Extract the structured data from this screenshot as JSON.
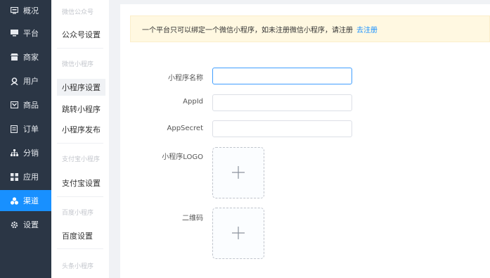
{
  "sidebar": {
    "items": [
      {
        "label": "概况",
        "icon": "dashboard-icon"
      },
      {
        "label": "平台",
        "icon": "monitor-icon"
      },
      {
        "label": "商家",
        "icon": "shop-icon"
      },
      {
        "label": "用户",
        "icon": "user-icon"
      },
      {
        "label": "商品",
        "icon": "goods-icon"
      },
      {
        "label": "订单",
        "icon": "order-icon"
      },
      {
        "label": "分销",
        "icon": "distribution-icon"
      },
      {
        "label": "应用",
        "icon": "apps-icon"
      },
      {
        "label": "渠道",
        "icon": "channel-icon",
        "active": true
      },
      {
        "label": "设置",
        "icon": "settings-icon"
      }
    ],
    "bg_color": "#2b3645",
    "active_color": "#1890ff"
  },
  "subnav": {
    "groups": {
      "wechat_official": "微信公众号",
      "wechat_mini": "微信小程序",
      "alipay_mini": "支付宝小程序",
      "baidu_mini": "百度小程序",
      "toutiao_mini": "头条小程序"
    },
    "items": {
      "official_settings": "公众号设置",
      "mini_settings": "小程序设置",
      "jump_mini": "跳转小程序",
      "mini_publish": "小程序发布",
      "alipay_settings": "支付宝设置",
      "baidu_settings": "百度设置"
    }
  },
  "notice": {
    "text": "一个平台只可以绑定一个微信小程序，如未注册微信小程序，请注册",
    "link": "去注册"
  },
  "form": {
    "name_label": "小程序名称",
    "appid_label": "AppId",
    "appsecret_label": "AppSecret",
    "logo_label": "小程序LOGO",
    "qrcode_label": "二维码",
    "name_value": "",
    "appid_value": "",
    "appsecret_value": ""
  }
}
